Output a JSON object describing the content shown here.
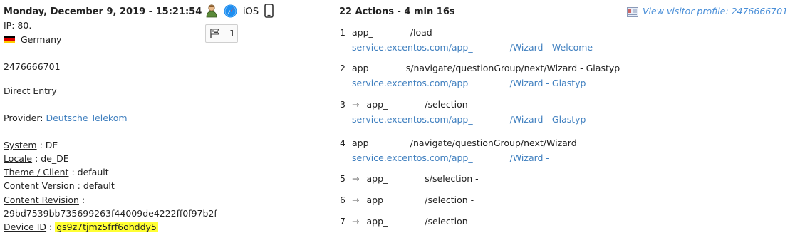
{
  "visitor": {
    "datetime": "Monday, December 9, 2019 - 15:21:54",
    "ip": "IP: 80.",
    "country": "Germany",
    "visitor_code": "2476666701",
    "referrer": "Direct Entry",
    "provider_label": "Provider: ",
    "provider_name": "Deutsche Telekom",
    "os": "iOS",
    "segment_count": "1",
    "icons": [
      "visitor-icon",
      "safari-compass-icon",
      "smartphone-icon",
      "flag-segment-icon"
    ]
  },
  "custom_vars": [
    {
      "label": "System",
      "sep": " : ",
      "value": "DE"
    },
    {
      "label": "Locale",
      "sep": " : ",
      "value": "de_DE"
    },
    {
      "label": "Theme / Client",
      "sep": " : ",
      "value": "default"
    },
    {
      "label": "Content Version",
      "sep": " : ",
      "value": "default"
    },
    {
      "label": "Content Revision",
      "sep": " :",
      "value": ""
    },
    {
      "label": "",
      "sep": "",
      "value": "29bd7539bb735699263f44009de4222ff0f97b2f"
    },
    {
      "label": "Device ID",
      "sep": " : ",
      "value": "gs9z7tjmz5frf6ohddy5"
    }
  ],
  "actions_header": "22 Actions - 4 min 16s",
  "view_profile": "View visitor profile: 2476666701",
  "actions": [
    {
      "num": "1",
      "arrow": "",
      "line1": "app_",
      "line1b": "/load",
      "line2": "service.excentos.com/app_",
      "line2b": "/Wizard - Welcome"
    },
    {
      "num": "2",
      "arrow": "",
      "line1": "app_",
      "line1b": "s/navigate/questionGroup/next/Wizard - Glastyp",
      "line2": "service.excentos.com/app_",
      "line2b": "/Wizard - Glastyp"
    },
    {
      "num": "3",
      "arrow": "→",
      "line1": "app_",
      "line1b": "/selection",
      "line2": "service.excentos.com/app_",
      "line2b": "/Wizard - Glastyp"
    },
    {
      "num": "4",
      "arrow": "",
      "line1": "app_",
      "line1b": "/navigate/questionGroup/next/Wizard",
      "line2": "service.excentos.com/app_",
      "line2b": "/Wizard -"
    },
    {
      "num": "5",
      "arrow": "→",
      "line1": "app_",
      "line1b": "s/selection -",
      "line2": "",
      "line2b": ""
    },
    {
      "num": "6",
      "arrow": "→",
      "line1": "app_",
      "line1b": "/selection -",
      "line2": "",
      "line2b": ""
    },
    {
      "num": "7",
      "arrow": "→",
      "line1": "app_",
      "line1b": "/selection",
      "line2": "",
      "line2b": ""
    }
  ]
}
